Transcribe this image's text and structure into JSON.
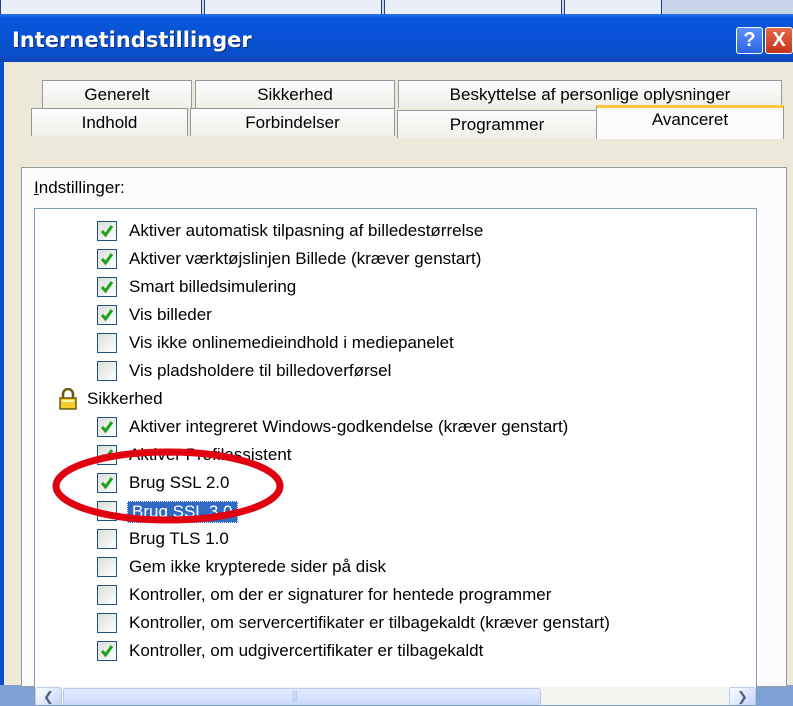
{
  "window": {
    "title": "Internetindstillinger",
    "help_label": "?",
    "close_label": "X"
  },
  "tabs_back": [
    "Generelt",
    "Sikkerhed",
    "Beskyttelse af personlige oplysninger"
  ],
  "tabs_front": [
    "Indhold",
    "Forbindelser",
    "Programmer",
    "Avanceret"
  ],
  "active_tab": "Avanceret",
  "settings_label_prefix": "I",
  "settings_label_rest": "ndstillinger:",
  "settings": [
    {
      "label": "Aktiver automatisk tilpasning af billedestørrelse",
      "checked": true
    },
    {
      "label": "Aktiver værktøjslinjen Billede (kræver genstart)",
      "checked": true
    },
    {
      "label": "Smart billedsimulering",
      "checked": true
    },
    {
      "label": "Vis billeder",
      "checked": true
    },
    {
      "label": "Vis ikke onlinemedieindhold i mediepanelet",
      "checked": false
    },
    {
      "label": "Vis pladsholdere til billedoverførsel",
      "checked": false
    },
    {
      "label": "Sikkerhed",
      "group": true
    },
    {
      "label": "Aktiver integreret Windows-godkendelse (kræver genstart)",
      "checked": true
    },
    {
      "label": "Aktiver Profilassistent",
      "checked": true
    },
    {
      "label": "Brug SSL 2.0",
      "checked": true
    },
    {
      "label": "Brug SSL 3.0",
      "checked": false,
      "selected": true
    },
    {
      "label": "Brug TLS 1.0",
      "checked": false
    },
    {
      "label": "Gem ikke krypterede sider på disk",
      "checked": false
    },
    {
      "label": "Kontroller, om der er signaturer for hentede programmer",
      "checked": false
    },
    {
      "label": "Kontroller, om servercertifikater er tilbagekaldt (kræver genstart)",
      "checked": false
    },
    {
      "label": "Kontroller, om udgivercertifikater er tilbagekaldt",
      "checked": true
    }
  ],
  "scrollbar_glyphs": {
    "up": "︿",
    "down": "﹀",
    "left": "❮",
    "right": "❯",
    "grip": "≡",
    "hgrip": "⫼"
  },
  "colors": {
    "highlight": "#316ac5",
    "check": "#21a121",
    "annotation": "#e0000f"
  }
}
